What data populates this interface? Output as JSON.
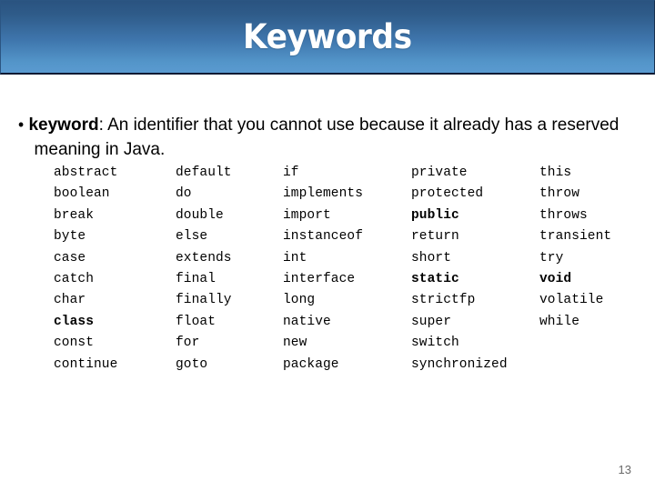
{
  "slide": {
    "title": "Keywords",
    "page_number": "13",
    "header_gradient_top": "#2a5380",
    "header_gradient_bottom": "#5a9ad0",
    "header_border": "#0c1a33",
    "title_color": "#ffffff",
    "body_text_color": "#000000",
    "page_number_color": "#6a6a6a"
  },
  "definition": {
    "bullet_glyph": "•",
    "term": "keyword",
    "separator": ": ",
    "text": "An identifier that you cannot use because it already has a reserved meaning in Java."
  },
  "keyword_table": {
    "columns": [
      {
        "items": [
          {
            "text": "abstract",
            "bold": false
          },
          {
            "text": "boolean",
            "bold": false
          },
          {
            "text": "break",
            "bold": false
          },
          {
            "text": "byte",
            "bold": false
          },
          {
            "text": "case",
            "bold": false
          },
          {
            "text": "catch",
            "bold": false
          },
          {
            "text": "char",
            "bold": false
          },
          {
            "text": "class",
            "bold": true
          },
          {
            "text": "const",
            "bold": false
          },
          {
            "text": "continue",
            "bold": false
          }
        ]
      },
      {
        "items": [
          {
            "text": "default",
            "bold": false
          },
          {
            "text": "do",
            "bold": false
          },
          {
            "text": "double",
            "bold": false
          },
          {
            "text": "else",
            "bold": false
          },
          {
            "text": "extends",
            "bold": false
          },
          {
            "text": "final",
            "bold": false
          },
          {
            "text": "finally",
            "bold": false
          },
          {
            "text": "float",
            "bold": false
          },
          {
            "text": "for",
            "bold": false
          },
          {
            "text": "goto",
            "bold": false
          }
        ]
      },
      {
        "items": [
          {
            "text": "if",
            "bold": false
          },
          {
            "text": "implements",
            "bold": false
          },
          {
            "text": "import",
            "bold": false
          },
          {
            "text": "instanceof",
            "bold": false
          },
          {
            "text": "int",
            "bold": false
          },
          {
            "text": "interface",
            "bold": false
          },
          {
            "text": "long",
            "bold": false
          },
          {
            "text": "native",
            "bold": false
          },
          {
            "text": "new",
            "bold": false
          },
          {
            "text": "package",
            "bold": false
          }
        ]
      },
      {
        "items": [
          {
            "text": "private",
            "bold": false
          },
          {
            "text": "protected",
            "bold": false
          },
          {
            "text": "public",
            "bold": true
          },
          {
            "text": "return",
            "bold": false
          },
          {
            "text": "short",
            "bold": false
          },
          {
            "text": "static",
            "bold": true
          },
          {
            "text": "strictfp",
            "bold": false
          },
          {
            "text": "super",
            "bold": false
          },
          {
            "text": "switch",
            "bold": false
          },
          {
            "text": "synchronized",
            "bold": false
          }
        ]
      },
      {
        "items": [
          {
            "text": "this",
            "bold": false
          },
          {
            "text": "throw",
            "bold": false
          },
          {
            "text": "throws",
            "bold": false
          },
          {
            "text": "transient",
            "bold": false
          },
          {
            "text": "try",
            "bold": false
          },
          {
            "text": "void",
            "bold": true
          },
          {
            "text": "volatile",
            "bold": false
          },
          {
            "text": "while",
            "bold": false
          },
          {
            "text": "",
            "bold": false
          },
          {
            "text": "",
            "bold": false
          }
        ]
      }
    ]
  }
}
